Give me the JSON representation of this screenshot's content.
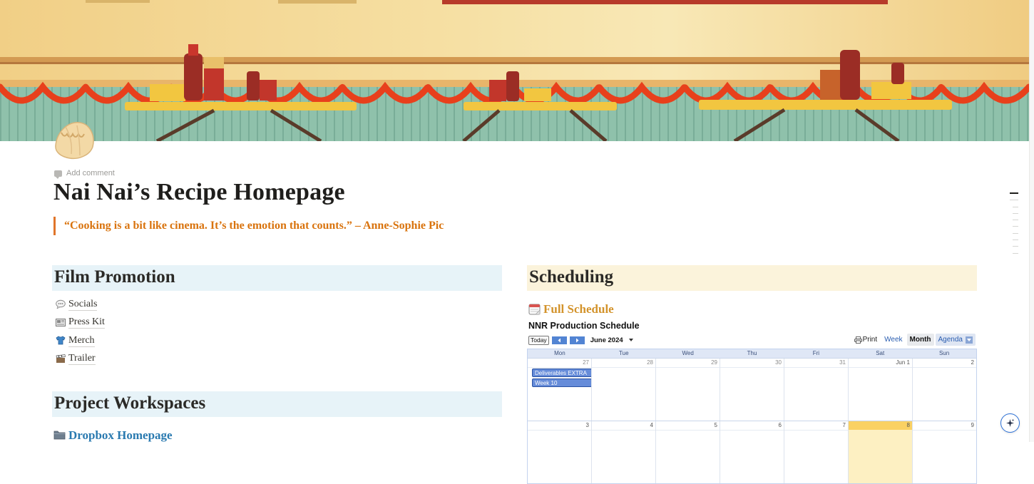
{
  "page": {
    "add_comment": "Add comment",
    "title": "Nai Nai’s Recipe Homepage",
    "quote": "“Cooking is a bit like cinema. It’s the emotion that counts.” – Anne-Sophie Pic"
  },
  "film_promotion": {
    "heading": "Film Promotion",
    "items": [
      {
        "label": "Socials",
        "icon": "speech-bubble-icon"
      },
      {
        "label": "Press Kit",
        "icon": "newspaper-icon"
      },
      {
        "label": "Merch",
        "icon": "t-shirt-icon"
      },
      {
        "label": "Trailer",
        "icon": "film-clapper-icon"
      }
    ]
  },
  "project_workspaces": {
    "heading": "Project Workspaces",
    "link": "Dropbox Homepage",
    "link_icon": "folder-icon"
  },
  "scheduling": {
    "heading": "Scheduling",
    "link": "Full Schedule",
    "link_icon": "calendar-icon",
    "calendar": {
      "title": "NNR Production Schedule",
      "today_label": "Today",
      "month_label": "June 2024",
      "print_label": "Print",
      "tabs": [
        "Week",
        "Month",
        "Agenda"
      ],
      "active_tab": "Month",
      "days_of_week": [
        "Mon",
        "Tue",
        "Wed",
        "Thu",
        "Fri",
        "Sat",
        "Sun"
      ],
      "weeks": [
        [
          "27",
          "28",
          "29",
          "30",
          "31",
          "Jun 1",
          "2"
        ],
        [
          "3",
          "4",
          "5",
          "6",
          "7",
          "8",
          "9"
        ]
      ],
      "events": [
        "Deliverables EXTRA",
        "Week 10"
      ],
      "today_date": "8"
    }
  },
  "colors": {
    "quote_accent": "#d9730d",
    "blue_heading_bg": "#e7f3f8",
    "yellow_heading_bg": "#fbf3db",
    "link_blue": "#2a7ab0",
    "link_orange": "#d3932b"
  }
}
